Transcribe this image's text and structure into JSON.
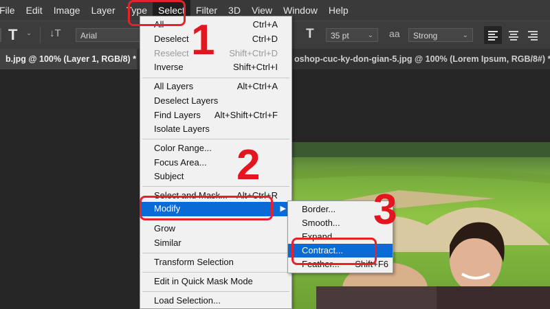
{
  "menubar": {
    "items": [
      "File",
      "Edit",
      "Image",
      "Layer",
      "Type",
      "Select",
      "Filter",
      "3D",
      "View",
      "Window",
      "Help"
    ]
  },
  "optionsbar": {
    "tool_glyph": "T",
    "orient_glyph": "↓T",
    "font_family": "Arial",
    "size_glyph": "T",
    "font_size": "35 pt",
    "aa_glyph": "aa",
    "anti_alias": "Strong"
  },
  "tabs": [
    {
      "label": "b.jpg @ 100% (Layer 1, RGB/8) *"
    },
    {
      "label": "oshop-cuc-ky-don-gian-5.jpg @ 100% (Lorem Ipsum, RGB/8#) *"
    }
  ],
  "select_menu": {
    "items": [
      {
        "label": "All",
        "shortcut": "Ctrl+A"
      },
      {
        "label": "Deselect",
        "shortcut": "Ctrl+D"
      },
      {
        "label": "Reselect",
        "shortcut": "Shift+Ctrl+D"
      },
      {
        "label": "Inverse",
        "shortcut": "Shift+Ctrl+I"
      },
      {
        "label": "All Layers",
        "shortcut": "Alt+Ctrl+A"
      },
      {
        "label": "Deselect Layers",
        "shortcut": ""
      },
      {
        "label": "Find Layers",
        "shortcut": "Alt+Shift+Ctrl+F"
      },
      {
        "label": "Isolate Layers",
        "shortcut": ""
      },
      {
        "label": "Color Range...",
        "shortcut": ""
      },
      {
        "label": "Focus Area...",
        "shortcut": ""
      },
      {
        "label": "Subject",
        "shortcut": ""
      },
      {
        "label": "Select and Mask...",
        "shortcut": "Alt+Ctrl+R"
      },
      {
        "label": "Modify",
        "shortcut": ""
      },
      {
        "label": "Grow",
        "shortcut": ""
      },
      {
        "label": "Similar",
        "shortcut": ""
      },
      {
        "label": "Transform Selection",
        "shortcut": ""
      },
      {
        "label": "Edit in Quick Mask Mode",
        "shortcut": ""
      },
      {
        "label": "Load Selection...",
        "shortcut": ""
      }
    ]
  },
  "modify_submenu": {
    "items": [
      {
        "label": "Border...",
        "shortcut": ""
      },
      {
        "label": "Smooth...",
        "shortcut": ""
      },
      {
        "label": "Expand...",
        "shortcut": ""
      },
      {
        "label": "Contract...",
        "shortcut": ""
      },
      {
        "label": "Feather...",
        "shortcut": "Shift+F6"
      }
    ]
  },
  "annotations": {
    "step1": "1",
    "step2": "2",
    "step3": "3",
    "color": "#e3151e"
  },
  "colors": {
    "highlight": "#0a6ad6",
    "menubar": "#3a3a3a"
  }
}
